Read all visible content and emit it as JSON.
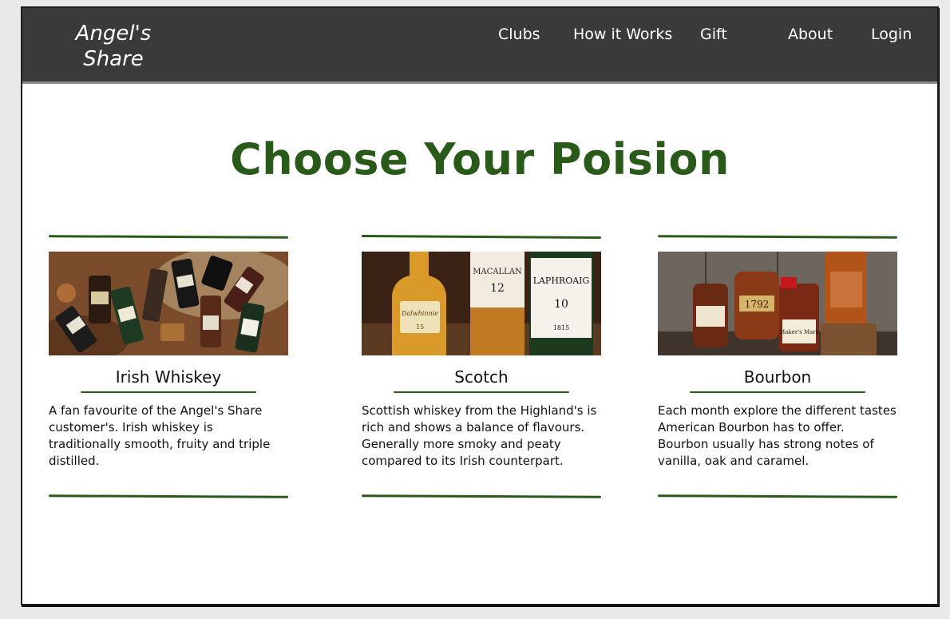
{
  "brand": {
    "line1": "Angel's",
    "line2": "Share"
  },
  "nav": {
    "clubs": "Clubs",
    "how_it_works": "How it Works",
    "gift": "Gift",
    "about": "About",
    "login": "Login"
  },
  "hero": {
    "title": "Choose Your Poision"
  },
  "cards": [
    {
      "title": "Irish Whiskey",
      "text": "A fan favourite of the Angel's Share customer's. Irish whiskey is traditionally smooth, fruity and triple distilled."
    },
    {
      "title": "Scotch",
      "text": "Scottish whiskey from the Highland's is rich and shows a balance of flavours. Generally more smoky and peaty compared to its Irish counterpart."
    },
    {
      "title": "Bourbon",
      "text": "Each month explore the different tastes American Bourbon has to offer. Bourbon usually has strong notes of vanilla, oak and caramel."
    }
  ],
  "labels": {
    "macallan": "MACALLAN",
    "macallan_age": "12",
    "laphroaig": "LAPHROAIG",
    "laphroaig_age": "10",
    "laphroaig_year": "1815",
    "dalwhinnie_age": "15",
    "bourbon_1792": "1792",
    "makers_mark": "Maker's Mark"
  },
  "colors": {
    "accent": "#2a5a1a",
    "navbar": "#3a3a3a"
  }
}
